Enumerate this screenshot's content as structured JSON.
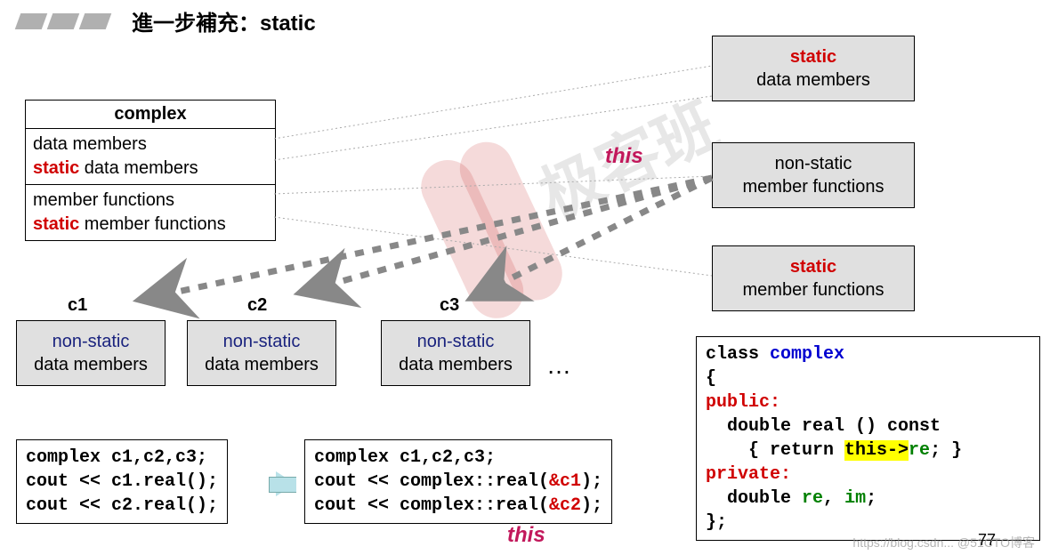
{
  "title": "進一步補充：static",
  "complex_table": {
    "header": "complex",
    "row1a": "data members",
    "row1b_static": "static",
    "row1b_rest": " data members",
    "row2a": "member functions",
    "row2b_static": "static",
    "row2b_rest": " member functions"
  },
  "right_boxes": {
    "b1_kw": "static",
    "b1_txt": "data members",
    "b2_kw": "non-static",
    "b2_txt": "member functions",
    "b3_kw": "static",
    "b3_txt": "member functions"
  },
  "objects": {
    "labels": [
      "c1",
      "c2",
      "c3"
    ],
    "box_kw": "non-static",
    "box_txt": "data members",
    "ellipsis": "…"
  },
  "this_top": "this",
  "this_bottom": "this",
  "code_left": {
    "l1": "complex c1,c2,c3;",
    "l2": "cout << c1.real();",
    "l3": "cout << c2.real();"
  },
  "code_mid": {
    "l1": "complex c1,c2,c3;",
    "l2a": "cout << complex::real(",
    "l2b": "&c1",
    "l2c": ");",
    "l3a": "cout << complex::real(",
    "l3b": "&c2",
    "l3c": ");"
  },
  "code_right": {
    "l1a": "class ",
    "l1b": "complex",
    "l2": "{",
    "l3": "public:",
    "l4": "  double real () const",
    "l5a": "    { return ",
    "l5b": "this->",
    "l5c": "re",
    "l5d": "; }",
    "l6": "private:",
    "l7a": "  double ",
    "l7b": "re",
    "l7c": ", ",
    "l7d": "im",
    "l7e": ";",
    "l8": "};"
  },
  "page_number": "77",
  "attribution": "https://blog.csdn... @51CTO博客"
}
